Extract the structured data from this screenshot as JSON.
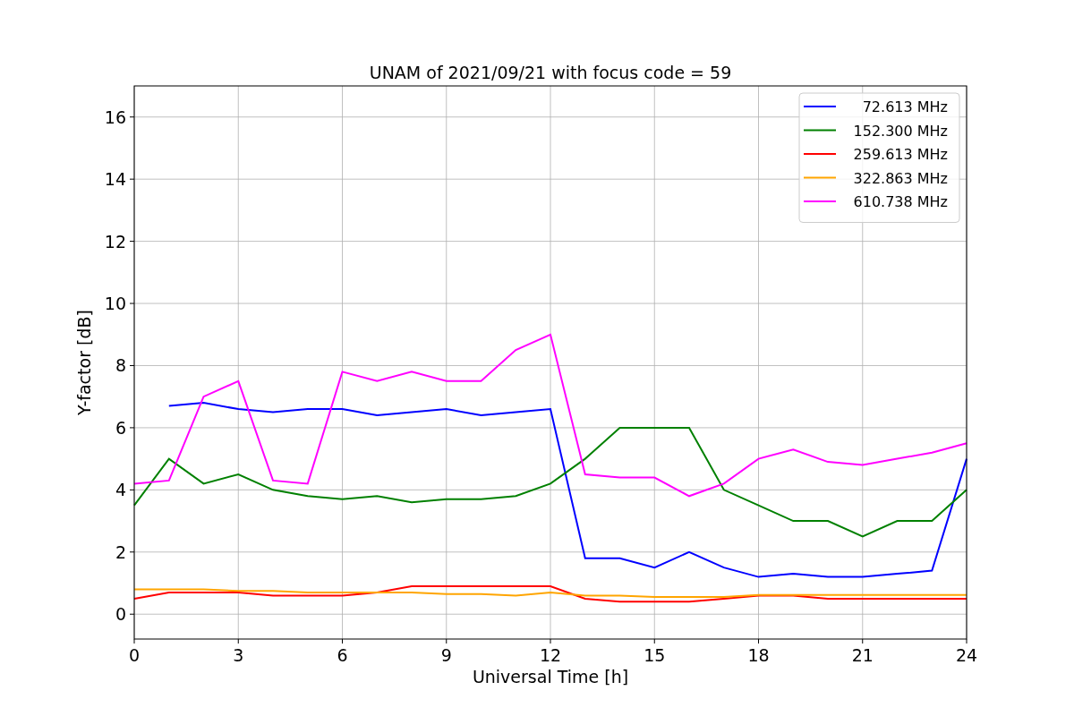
{
  "figure": {
    "chart_data": {
      "type": "line",
      "title": "UNAM of 2021/09/21 with focus code = 59",
      "xlabel": "Universal Time [h]",
      "ylabel": "Y-factor [dB]",
      "x": [
        0,
        1,
        2,
        3,
        4,
        5,
        6,
        7,
        8,
        9,
        10,
        11,
        12,
        13,
        14,
        15,
        16,
        17,
        18,
        19,
        20,
        21,
        22,
        23,
        24
      ],
      "series": [
        {
          "name": " 72.613 MHz",
          "color": "#0000ff",
          "values": [
            null,
            6.7,
            6.8,
            6.6,
            6.5,
            6.6,
            6.6,
            6.4,
            6.5,
            6.6,
            6.4,
            6.5,
            6.6,
            1.8,
            1.8,
            1.5,
            2.0,
            1.5,
            1.2,
            1.3,
            1.2,
            1.2,
            1.3,
            1.4,
            5.0
          ]
        },
        {
          "name": "152.300 MHz",
          "color": "#008000",
          "values": [
            3.5,
            5.0,
            4.2,
            4.5,
            4.0,
            3.8,
            3.7,
            3.8,
            3.6,
            3.7,
            3.7,
            3.8,
            4.2,
            5.0,
            6.0,
            6.0,
            6.0,
            4.0,
            3.5,
            3.0,
            3.0,
            2.5,
            3.0,
            3.0,
            4.0
          ]
        },
        {
          "name": "259.613 MHz",
          "color": "#ff0000",
          "values": [
            0.5,
            0.7,
            0.7,
            0.7,
            0.6,
            0.6,
            0.6,
            0.7,
            0.9,
            0.9,
            0.9,
            0.9,
            0.9,
            0.5,
            0.4,
            0.4,
            0.4,
            0.5,
            0.6,
            0.6,
            0.5,
            0.5,
            0.5,
            0.5,
            0.5
          ]
        },
        {
          "name": "322.863 MHz",
          "color": "#ffa500",
          "values": [
            0.8,
            0.8,
            0.8,
            0.75,
            0.75,
            0.7,
            0.7,
            0.7,
            0.7,
            0.65,
            0.65,
            0.6,
            0.7,
            0.6,
            0.6,
            0.55,
            0.55,
            0.55,
            0.62,
            0.62,
            0.62,
            0.62,
            0.62,
            0.62,
            0.62
          ]
        },
        {
          "name": "610.738 MHz",
          "color": "#ff00ff",
          "values": [
            4.2,
            4.3,
            7.0,
            7.5,
            4.3,
            4.2,
            7.8,
            7.5,
            7.8,
            7.5,
            7.5,
            8.5,
            9.0,
            4.5,
            4.4,
            4.4,
            3.8,
            4.2,
            5.0,
            5.3,
            4.9,
            4.8,
            5.0,
            5.2,
            5.5
          ]
        }
      ],
      "xlim": [
        0,
        24
      ],
      "ylim": [
        -0.8,
        17
      ],
      "xticks": [
        0,
        3,
        6,
        9,
        12,
        15,
        18,
        21,
        24
      ],
      "yticks": [
        0,
        2,
        4,
        6,
        8,
        10,
        12,
        14,
        16
      ],
      "grid": true,
      "legend": true
    }
  }
}
